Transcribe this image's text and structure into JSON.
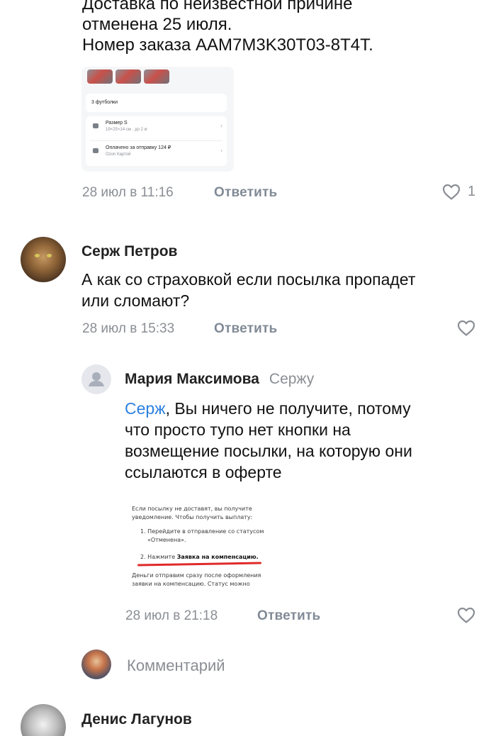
{
  "first_comment": {
    "text_lines": [
      "Доставка по неизвестной причине",
      "отменена 25 июля.",
      "Номер заказа AAM7M3K30T03-8T4T."
    ],
    "card": {
      "title": "3 футболки",
      "row1_title": "Размер S",
      "row1_sub": "19×25×14 см · до 2 кг",
      "row2_title": "Оплачено за отправку 124 ₽",
      "row2_sub": "Ozon Картой"
    },
    "time": "28 июл в 11:16",
    "reply_label": "Ответить",
    "likes": "1"
  },
  "comment_serzh": {
    "author": "Серж Петров",
    "text_lines": [
      "А как со страховкой если посылка пропадет",
      "или сломают?"
    ],
    "time": "28 июл в 15:33",
    "reply_label": "Ответить"
  },
  "reply_maria": {
    "author": "Мария Максимова",
    "reply_to": "Сержу",
    "mention": "Серж",
    "text_first_line_rest": ", Вы ничего не получите, потому",
    "text_lines": [
      "что просто тупо нет кнопки на",
      "возмещение посылки, на которую они",
      "ссылаются в оферте"
    ],
    "doc": {
      "line1": "Если посылку не доставят, вы получите",
      "line2": "уведомление. Чтобы получить выплату:",
      "line3": "1. Перейдите в отправление со статусом",
      "line4": "«Отменена».",
      "line5_prefix": "2. Нажмите ",
      "line5_bold": "Заявка на компенсацию.",
      "line6": "Деньги отправим сразу после оформления",
      "line7": "заявки на компенсацию. Статус можно"
    },
    "time": "28 июл в 21:18",
    "reply_label": "Ответить"
  },
  "comment_input": {
    "placeholder": "Комментарий"
  },
  "comment_denis": {
    "author": "Денис Лагунов"
  },
  "colors": {
    "mention": "#2d81e0",
    "meta": "#8a8e94",
    "reply": "#818a96",
    "underline": "#e02a2a"
  }
}
